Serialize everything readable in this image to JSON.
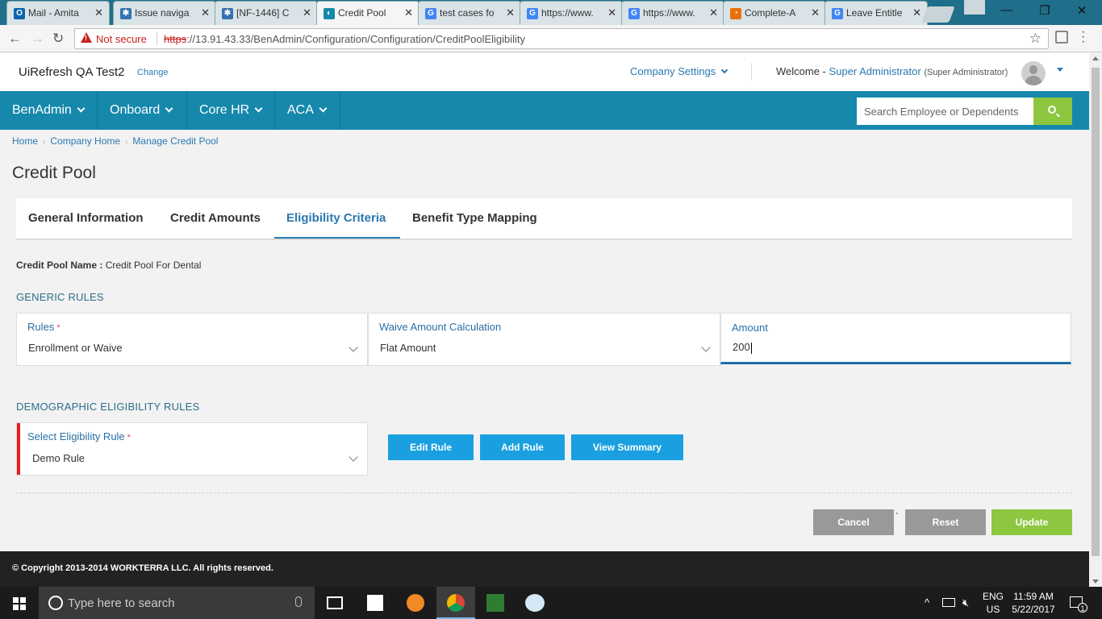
{
  "browser": {
    "tabs": [
      {
        "title": "Mail - Amita",
        "icon_color": "#0a64ad",
        "icon_glyph": "O"
      },
      {
        "title": "Issue naviga",
        "icon_color": "#3572b0",
        "icon_glyph": "✱"
      },
      {
        "title": "[NF-1446] C",
        "icon_color": "#3572b0",
        "icon_glyph": "✱"
      },
      {
        "title": "Credit Pool",
        "icon_color": "#1588ab",
        "icon_glyph": "◐"
      },
      {
        "title": "test cases fo",
        "icon_color": "#4285f4",
        "icon_glyph": "G"
      },
      {
        "title": "https://www.",
        "icon_color": "#4285f4",
        "icon_glyph": "G"
      },
      {
        "title": "https://www.",
        "icon_color": "#4285f4",
        "icon_glyph": "G"
      },
      {
        "title": "Complete-A",
        "icon_color": "#e8710a",
        "icon_glyph": "◔"
      },
      {
        "title": "Leave Entitle",
        "icon_color": "#4285f4",
        "icon_glyph": "G"
      }
    ],
    "security_label": "Not secure",
    "url_scheme": "https",
    "url_rest": "://13.91.43.33/BenAdmin/Configuration/Configuration/CreditPoolEligibility"
  },
  "header": {
    "company_name": "UiRefresh QA Test2",
    "change_label": "Change",
    "company_settings": "Company Settings",
    "welcome_label": "Welcome -",
    "user_name": "Super Administrator",
    "user_role": "(Super Administrator)"
  },
  "nav": {
    "items": [
      "BenAdmin",
      "Onboard",
      "Core HR",
      "ACA"
    ],
    "search_placeholder": "Search Employee or Dependents"
  },
  "breadcrumb": [
    "Home",
    "Company Home",
    "Manage Credit Pool"
  ],
  "page_title": "Credit Pool",
  "tabs": [
    "General Information",
    "Credit Amounts",
    "Eligibility Criteria",
    "Benefit Type Mapping"
  ],
  "active_tab": "Eligibility Criteria",
  "credit_pool": {
    "name_label": "Credit Pool Name :",
    "name_value": "Credit Pool For Dental"
  },
  "generic_rules": {
    "heading": "GENERIC RULES",
    "rules_label": "Rules",
    "rules_value": "Enrollment or Waive",
    "waive_label": "Waive Amount Calculation",
    "waive_value": "Flat Amount",
    "amount_label": "Amount",
    "amount_value": "200"
  },
  "demographic": {
    "heading": "DEMOGRAPHIC ELIGIBILITY RULES",
    "select_label": "Select Eligibility Rule",
    "select_value": "Demo Rule",
    "edit_rule": "Edit Rule",
    "add_rule": "Add Rule",
    "view_summary": "View Summary"
  },
  "actions": {
    "cancel": "Cancel",
    "reset": "Reset",
    "update": "Update",
    "backtick": "`"
  },
  "required_mark": "*",
  "footer": "© Copyright 2013-2014 WORKTERRA LLC. All rights reserved.",
  "taskbar": {
    "search_placeholder": "Type here to search",
    "lang_top": "ENG",
    "lang_bottom": "US",
    "time": "11:59 AM",
    "date": "5/22/2017",
    "notification_count": "1"
  },
  "colors": {
    "nav_bg": "#1588ab",
    "accent_blue": "#2a7ab0",
    "button_blue": "#1aa0e0",
    "green": "#8dc63f",
    "required_red": "#e02020"
  }
}
